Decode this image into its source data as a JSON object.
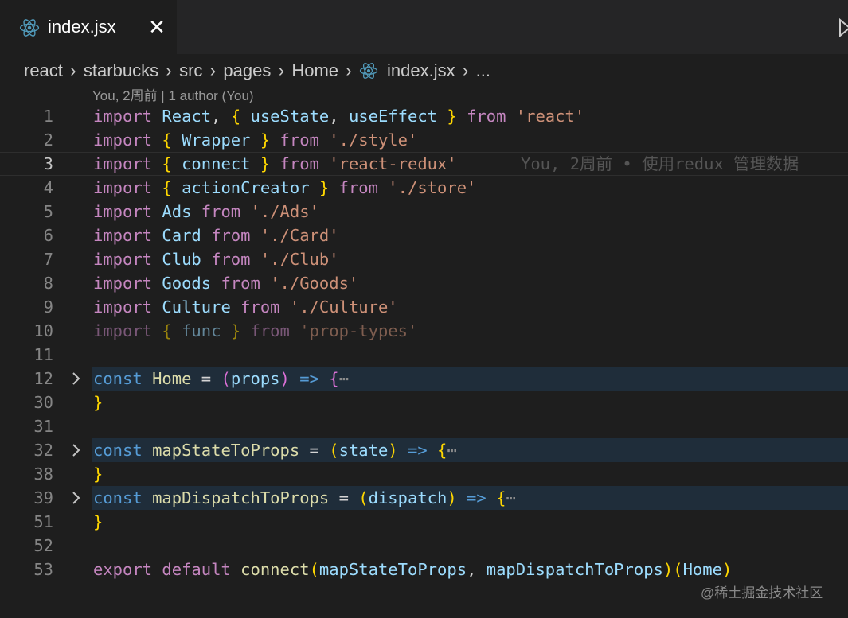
{
  "tab": {
    "title": "index.jsx",
    "close": "✕",
    "icon": "react-icon"
  },
  "breadcrumb": [
    "react",
    "starbucks",
    "src",
    "pages",
    "Home",
    "index.jsx",
    "..."
  ],
  "breadcrumb_sep": "›",
  "blame": {
    "header": "You, 2周前 | 1 author (You)",
    "inline": "You, 2周前 • 使用redux 管理数据"
  },
  "lines": [
    {
      "num": "1",
      "tokens": [
        [
          "k",
          "import"
        ],
        [
          "t",
          " "
        ],
        [
          "v",
          "React"
        ],
        [
          "t",
          ", "
        ],
        [
          "y",
          "{"
        ],
        [
          "t",
          " "
        ],
        [
          "v",
          "useState"
        ],
        [
          "t",
          ", "
        ],
        [
          "v",
          "useEffect"
        ],
        [
          "t",
          " "
        ],
        [
          "y",
          "}"
        ],
        [
          "t",
          " "
        ],
        [
          "k",
          "from"
        ],
        [
          "t",
          " "
        ],
        [
          "s",
          "'react'"
        ]
      ]
    },
    {
      "num": "2",
      "tokens": [
        [
          "k",
          "import"
        ],
        [
          "t",
          " "
        ],
        [
          "y",
          "{"
        ],
        [
          "t",
          " "
        ],
        [
          "v",
          "Wrapper"
        ],
        [
          "t",
          " "
        ],
        [
          "y",
          "}"
        ],
        [
          "t",
          " "
        ],
        [
          "k",
          "from"
        ],
        [
          "t",
          " "
        ],
        [
          "s",
          "'./style'"
        ]
      ]
    },
    {
      "num": "3",
      "tokens": [
        [
          "k",
          "import"
        ],
        [
          "t",
          " "
        ],
        [
          "y",
          "{"
        ],
        [
          "t",
          " "
        ],
        [
          "v",
          "connect"
        ],
        [
          "t",
          " "
        ],
        [
          "y",
          "}"
        ],
        [
          "t",
          " "
        ],
        [
          "k",
          "from"
        ],
        [
          "t",
          " "
        ],
        [
          "s",
          "'react-redux'"
        ]
      ]
    },
    {
      "num": "4",
      "tokens": [
        [
          "k",
          "import"
        ],
        [
          "t",
          " "
        ],
        [
          "y",
          "{"
        ],
        [
          "t",
          " "
        ],
        [
          "v",
          "actionCreator"
        ],
        [
          "t",
          " "
        ],
        [
          "y",
          "}"
        ],
        [
          "t",
          " "
        ],
        [
          "k",
          "from"
        ],
        [
          "t",
          " "
        ],
        [
          "s",
          "'./store'"
        ]
      ]
    },
    {
      "num": "5",
      "tokens": [
        [
          "k",
          "import"
        ],
        [
          "t",
          " "
        ],
        [
          "v",
          "Ads"
        ],
        [
          "t",
          " "
        ],
        [
          "k",
          "from"
        ],
        [
          "t",
          " "
        ],
        [
          "s",
          "'./Ads'"
        ]
      ]
    },
    {
      "num": "6",
      "tokens": [
        [
          "k",
          "import"
        ],
        [
          "t",
          " "
        ],
        [
          "v",
          "Card"
        ],
        [
          "t",
          " "
        ],
        [
          "k",
          "from"
        ],
        [
          "t",
          " "
        ],
        [
          "s",
          "'./Card'"
        ]
      ]
    },
    {
      "num": "7",
      "tokens": [
        [
          "k",
          "import"
        ],
        [
          "t",
          " "
        ],
        [
          "v",
          "Club"
        ],
        [
          "t",
          " "
        ],
        [
          "k",
          "from"
        ],
        [
          "t",
          " "
        ],
        [
          "s",
          "'./Club'"
        ]
      ]
    },
    {
      "num": "8",
      "tokens": [
        [
          "k",
          "import"
        ],
        [
          "t",
          " "
        ],
        [
          "v",
          "Goods"
        ],
        [
          "t",
          " "
        ],
        [
          "k",
          "from"
        ],
        [
          "t",
          " "
        ],
        [
          "s",
          "'./Goods'"
        ]
      ]
    },
    {
      "num": "9",
      "tokens": [
        [
          "k",
          "import"
        ],
        [
          "t",
          " "
        ],
        [
          "v",
          "Culture"
        ],
        [
          "t",
          " "
        ],
        [
          "k",
          "from"
        ],
        [
          "t",
          " "
        ],
        [
          "s",
          "'./Culture'"
        ]
      ]
    },
    {
      "num": "10",
      "tokens": [
        [
          "k",
          "import"
        ],
        [
          "t",
          " "
        ],
        [
          "y",
          "{"
        ],
        [
          "t",
          " "
        ],
        [
          "v",
          "func"
        ],
        [
          "t",
          " "
        ],
        [
          "y",
          "}"
        ],
        [
          "t",
          " "
        ],
        [
          "k",
          "from"
        ],
        [
          "t",
          " "
        ],
        [
          "s",
          "'prop-types'"
        ]
      ]
    },
    {
      "num": "11",
      "tokens": []
    },
    {
      "num": "12",
      "tokens": [
        [
          "b",
          "const"
        ],
        [
          "t",
          " "
        ],
        [
          "f",
          "Home"
        ],
        [
          "t",
          " = "
        ],
        [
          "p",
          "("
        ],
        [
          "v",
          "props"
        ],
        [
          "p",
          ")"
        ],
        [
          "t",
          " "
        ],
        [
          "b",
          "=>"
        ],
        [
          "t",
          " "
        ],
        [
          "p",
          "{"
        ],
        [
          "ell",
          "⋯"
        ]
      ]
    },
    {
      "num": "30",
      "tokens": [
        [
          "y",
          "}"
        ]
      ]
    },
    {
      "num": "31",
      "tokens": []
    },
    {
      "num": "32",
      "tokens": [
        [
          "b",
          "const"
        ],
        [
          "t",
          " "
        ],
        [
          "f",
          "mapStateToProps"
        ],
        [
          "t",
          " = "
        ],
        [
          "y",
          "("
        ],
        [
          "v",
          "state"
        ],
        [
          "y",
          ")"
        ],
        [
          "t",
          " "
        ],
        [
          "b",
          "=>"
        ],
        [
          "t",
          " "
        ],
        [
          "y",
          "{"
        ],
        [
          "ell",
          "⋯"
        ]
      ]
    },
    {
      "num": "38",
      "tokens": [
        [
          "y",
          "}"
        ]
      ]
    },
    {
      "num": "39",
      "tokens": [
        [
          "b",
          "const"
        ],
        [
          "t",
          " "
        ],
        [
          "f",
          "mapDispatchToProps"
        ],
        [
          "t",
          " = "
        ],
        [
          "y",
          "("
        ],
        [
          "v",
          "dispatch"
        ],
        [
          "y",
          ")"
        ],
        [
          "t",
          " "
        ],
        [
          "b",
          "=>"
        ],
        [
          "t",
          " "
        ],
        [
          "y",
          "{"
        ],
        [
          "ell",
          "⋯"
        ]
      ]
    },
    {
      "num": "51",
      "tokens": [
        [
          "y",
          "}"
        ]
      ]
    },
    {
      "num": "52",
      "tokens": []
    },
    {
      "num": "53",
      "tokens": [
        [
          "k",
          "export"
        ],
        [
          "t",
          " "
        ],
        [
          "k",
          "default"
        ],
        [
          "t",
          " "
        ],
        [
          "f",
          "connect"
        ],
        [
          "y",
          "("
        ],
        [
          "v",
          "mapStateToProps"
        ],
        [
          "t",
          ", "
        ],
        [
          "v",
          "mapDispatchToProps"
        ],
        [
          "y",
          ")"
        ],
        [
          "y",
          "("
        ],
        [
          "v",
          "Home"
        ],
        [
          "y",
          ")"
        ]
      ]
    }
  ],
  "watermark": "@稀土掘金技术社区",
  "colors": {
    "background": "#1e1e1e",
    "tabbar": "#252526",
    "keyword": "#c586c0",
    "storage": "#569cd6",
    "variable": "#9cdcfe",
    "function": "#dcdcaa",
    "string": "#ce9178",
    "bracket_gold": "#ffd700",
    "bracket_orchid": "#da70d6",
    "folded_band": "#1f2d3a"
  }
}
